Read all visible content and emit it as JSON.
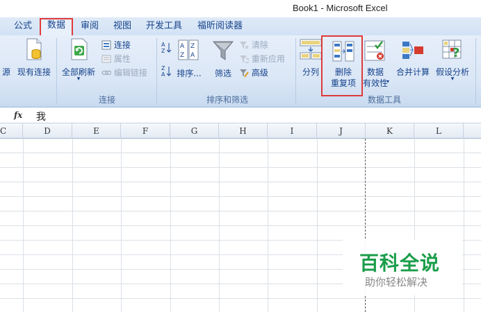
{
  "window": {
    "title": "Book1 - Microsoft Excel"
  },
  "tabs": [
    {
      "label": "公式"
    },
    {
      "label": "数据"
    },
    {
      "label": "审阅"
    },
    {
      "label": "视图"
    },
    {
      "label": "开发工具"
    },
    {
      "label": "福昕阅读器"
    }
  ],
  "active_tab": "数据",
  "ribbon": {
    "get_external": {
      "source_label": "源",
      "existing_connections_label": "现有连接"
    },
    "connections": {
      "group_label": "连接",
      "refresh_all_label": "全部刷新",
      "refresh_all_arrow": "▾",
      "connections_label": "连接",
      "properties_label": "属性",
      "edit_links_label": "编辑链接"
    },
    "sort_filter": {
      "group_label": "排序和筛选",
      "sort_label": "排序...",
      "filter_label": "筛选",
      "clear_label": "清除",
      "reapply_label": "重新应用",
      "advanced_label": "高级"
    },
    "data_tools": {
      "group_label": "数据工具",
      "text_to_columns_label": "分列",
      "remove_duplicates_line1": "删除",
      "remove_duplicates_line2": "重复项",
      "data_validation_line1": "数据",
      "data_validation_line2": "有效性",
      "data_validation_arrow": "▾",
      "consolidate_label": "合并计算",
      "what_if_label": "假设分析",
      "what_if_arrow": "▾"
    }
  },
  "formula_bar": {
    "fx_label": "fx",
    "content": "我"
  },
  "columns": [
    "C",
    "D",
    "E",
    "F",
    "G",
    "H",
    "I",
    "J",
    "K",
    "L"
  ],
  "watermark": {
    "main": "百科全说",
    "sub": "助你轻松解决"
  },
  "colors": {
    "highlight": "#e03a3a",
    "watermark_green": "#1a9d4a",
    "ribbon_text": "#15428b"
  }
}
